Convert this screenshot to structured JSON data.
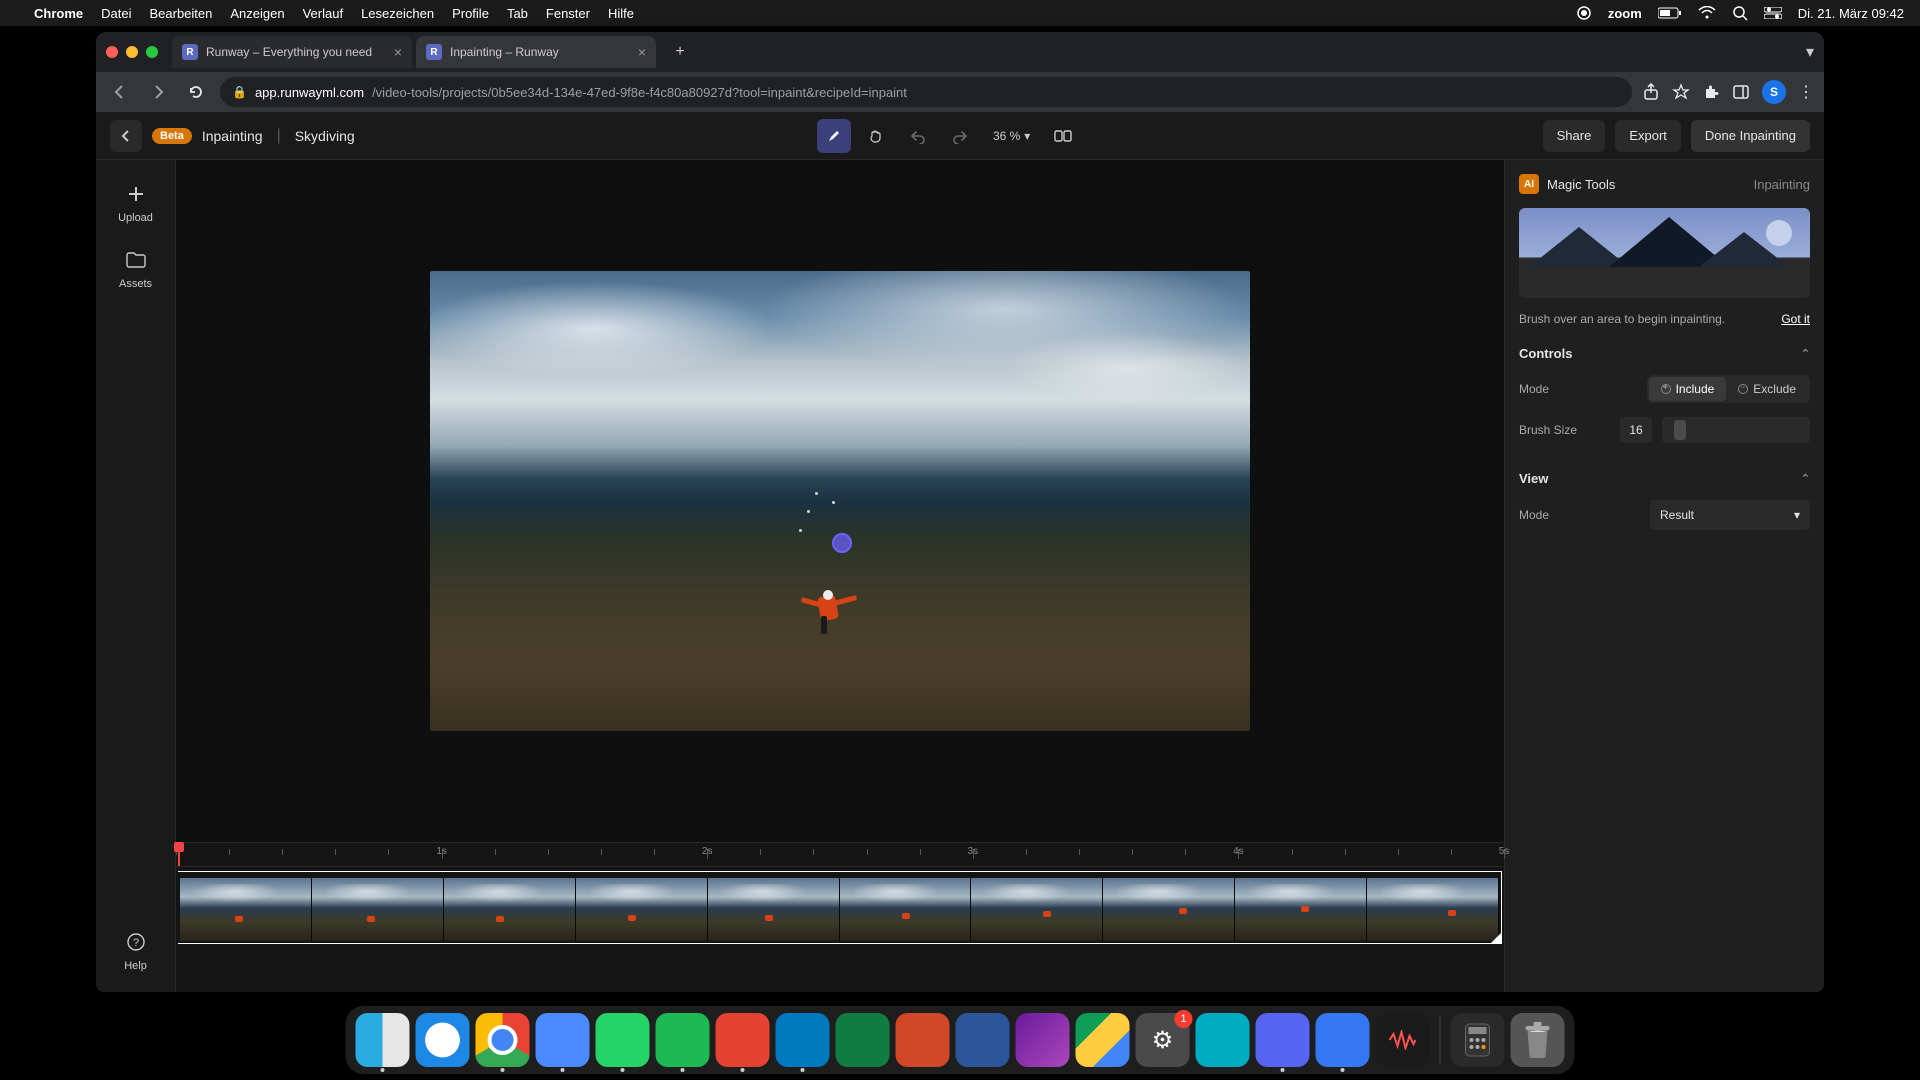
{
  "menubar": {
    "app": "Chrome",
    "items": [
      "Datei",
      "Bearbeiten",
      "Anzeigen",
      "Verlauf",
      "Lesezeichen",
      "Profile",
      "Tab",
      "Fenster",
      "Hilfe"
    ],
    "zoom_label": "zoom",
    "datetime": "Di. 21. März  09:42"
  },
  "tabs": [
    {
      "title": "Runway – Everything you need",
      "active": false
    },
    {
      "title": "Inpainting – Runway",
      "active": true
    }
  ],
  "address": {
    "host": "app.runwayml.com",
    "path": "/video-tools/projects/0b5ee34d-134e-47ed-9f8e-f4c80a80927d?tool=inpaint&recipeId=inpaint"
  },
  "avatar_initial": "S",
  "topbar": {
    "beta": "Beta",
    "tool": "Inpainting",
    "project": "Skydiving",
    "zoom": "36 %",
    "share": "Share",
    "export": "Export",
    "done": "Done Inpainting"
  },
  "leftrail": {
    "upload": "Upload",
    "assets": "Assets",
    "help": "Help"
  },
  "rightpanel": {
    "magic": "Magic Tools",
    "tool_name": "Inpainting",
    "hint": "Brush over an area to begin inpainting.",
    "gotit": "Got it",
    "controls": "Controls",
    "mode_label": "Mode",
    "include": "Include",
    "exclude": "Exclude",
    "brush_label": "Brush Size",
    "brush_value": "16",
    "view": "View",
    "view_mode_label": "Mode",
    "view_mode_value": "Result"
  },
  "timeline": {
    "ticks": [
      "1s",
      "2s",
      "3s",
      "4s",
      "5s"
    ],
    "thumbs": 10,
    "diver_positions": [
      {
        "l": 42,
        "t": 60
      },
      {
        "l": 42,
        "t": 60
      },
      {
        "l": 40,
        "t": 60
      },
      {
        "l": 40,
        "t": 58
      },
      {
        "l": 44,
        "t": 58
      },
      {
        "l": 48,
        "t": 56
      },
      {
        "l": 55,
        "t": 52
      },
      {
        "l": 58,
        "t": 48
      },
      {
        "l": 50,
        "t": 44
      },
      {
        "l": 62,
        "t": 50
      }
    ]
  },
  "dock": {
    "badge_settings": "1"
  }
}
